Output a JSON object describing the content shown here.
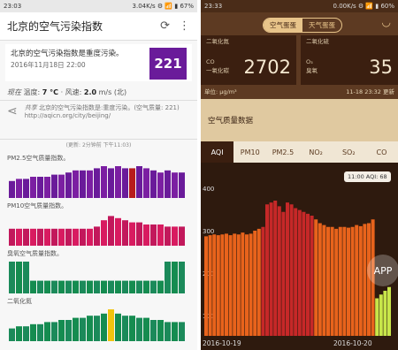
{
  "left": {
    "status": {
      "time": "23:03",
      "right": "3.04K/s ⚙ 📶 ▮ 67%"
    },
    "title": "北京的空气污染指数",
    "headline": "北京的空气污染指数是重度污染。",
    "date": "2016年11月18日 22:00",
    "aqi": "221",
    "aqi_color": "#6a1b9a",
    "current_label": "现在",
    "temp_label": "温度:",
    "temp": "7 °C",
    "wind_label": "· 风速:",
    "wind": "2.0",
    "wind_unit": "m/s (北)",
    "share_prefix": "共享",
    "share_text": "北京的空气污染指数是:重度污染。(空气质量: 221)",
    "share_url": "http://aqicn.org/city/beijing/",
    "updated": "(更新: 2分钟前 下午11:03)",
    "charts": [
      {
        "name": "PM2.5空气质量指数。",
        "colors": [
          "#6a1b9a",
          "#7b1fa2",
          "#8e24aa",
          "#b71c1c"
        ],
        "values": [
          8,
          9,
          9,
          10,
          10,
          10,
          11,
          11,
          12,
          13,
          13,
          13,
          14,
          15,
          14,
          15,
          14,
          14,
          15,
          14,
          13,
          12,
          13,
          12,
          12
        ]
      },
      {
        "name": "PM10空气质量指数。",
        "colors": [
          "#c2185b",
          "#d81b60",
          "#6a1b9a",
          "#8e24aa"
        ],
        "values": [
          8,
          8,
          8,
          8,
          8,
          8,
          8,
          8,
          8,
          8,
          8,
          8,
          9,
          12,
          14,
          13,
          12,
          11,
          11,
          10,
          10,
          10,
          9,
          9,
          9
        ]
      },
      {
        "name": "臭氧空气质量指数。",
        "colors": [
          "#1b8a5a",
          "#158c50",
          "#1b8a5a",
          "#15804b"
        ],
        "values": [
          15,
          15,
          15,
          6,
          6,
          6,
          6,
          6,
          6,
          6,
          6,
          6,
          6,
          6,
          6,
          6,
          6,
          6,
          6,
          6,
          6,
          6,
          15,
          15,
          15
        ]
      },
      {
        "name": "二氧化氮",
        "colors": [
          "#1b8a5a",
          "#158c50",
          "#f1c40f",
          "#15804b"
        ],
        "values": [
          6,
          7,
          7,
          8,
          8,
          9,
          9,
          10,
          10,
          11,
          11,
          12,
          12,
          13,
          15,
          13,
          12,
          12,
          11,
          11,
          10,
          10,
          9,
          9,
          9
        ]
      }
    ],
    "icons": {
      "refresh": "refresh-icon",
      "menu": "more-vert-icon",
      "share": "share-icon"
    }
  },
  "right": {
    "status": {
      "time": "23:33",
      "right": "0.00K/s ⚙ 📶 ▮ 60%"
    },
    "tab_air": "空气蛋蛋",
    "tab_weather": "天气蛋蛋",
    "no2_label": "二氧化氮",
    "co_label1": "CO",
    "co_label2": "一氧化碳",
    "co_value": "2702",
    "o3_label1": "O₃",
    "o3_label2": "臭氧",
    "o3_value": "35",
    "so2_label": "二氧化硫",
    "unit": "单位: μg/m³",
    "update_time": "11-18 23:32 更新",
    "section_title": "空气质量数据",
    "tabs": [
      "AQI",
      "PM10",
      "PM2.5",
      "NO₂",
      "SO₂",
      "CO"
    ],
    "y_labels": [
      "400",
      "300",
      "200",
      "100"
    ],
    "x_labels": [
      "2016-10-19",
      "2016-10-20"
    ],
    "tooltip": "11:00  AQI: 68",
    "watermark": "APP"
  }
}
